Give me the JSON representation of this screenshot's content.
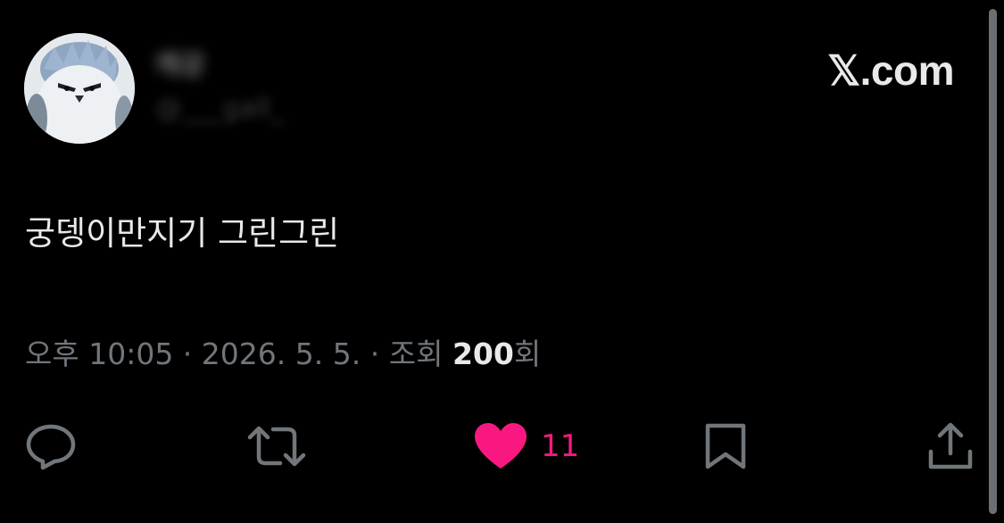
{
  "header": {
    "display_name": "캐강",
    "handle": "@___gall_",
    "brand": "𝕏.com"
  },
  "tweet": {
    "text": "궁뎅이만지기 그린그린",
    "time": "오후 10:05",
    "separator": " · ",
    "date": "2026. 5. 5.",
    "views_prefix": "조회 ",
    "views_count": "200",
    "views_suffix": "회"
  },
  "actions": {
    "reply_icon": "reply-icon",
    "retweet_icon": "retweet-icon",
    "like_icon": "heart-icon",
    "like_count": "11",
    "bookmark_icon": "bookmark-icon",
    "share_icon": "share-icon"
  },
  "colors": {
    "background": "#000000",
    "text_primary": "#e7e9ea",
    "text_secondary": "#71767b",
    "like": "#f91880"
  }
}
